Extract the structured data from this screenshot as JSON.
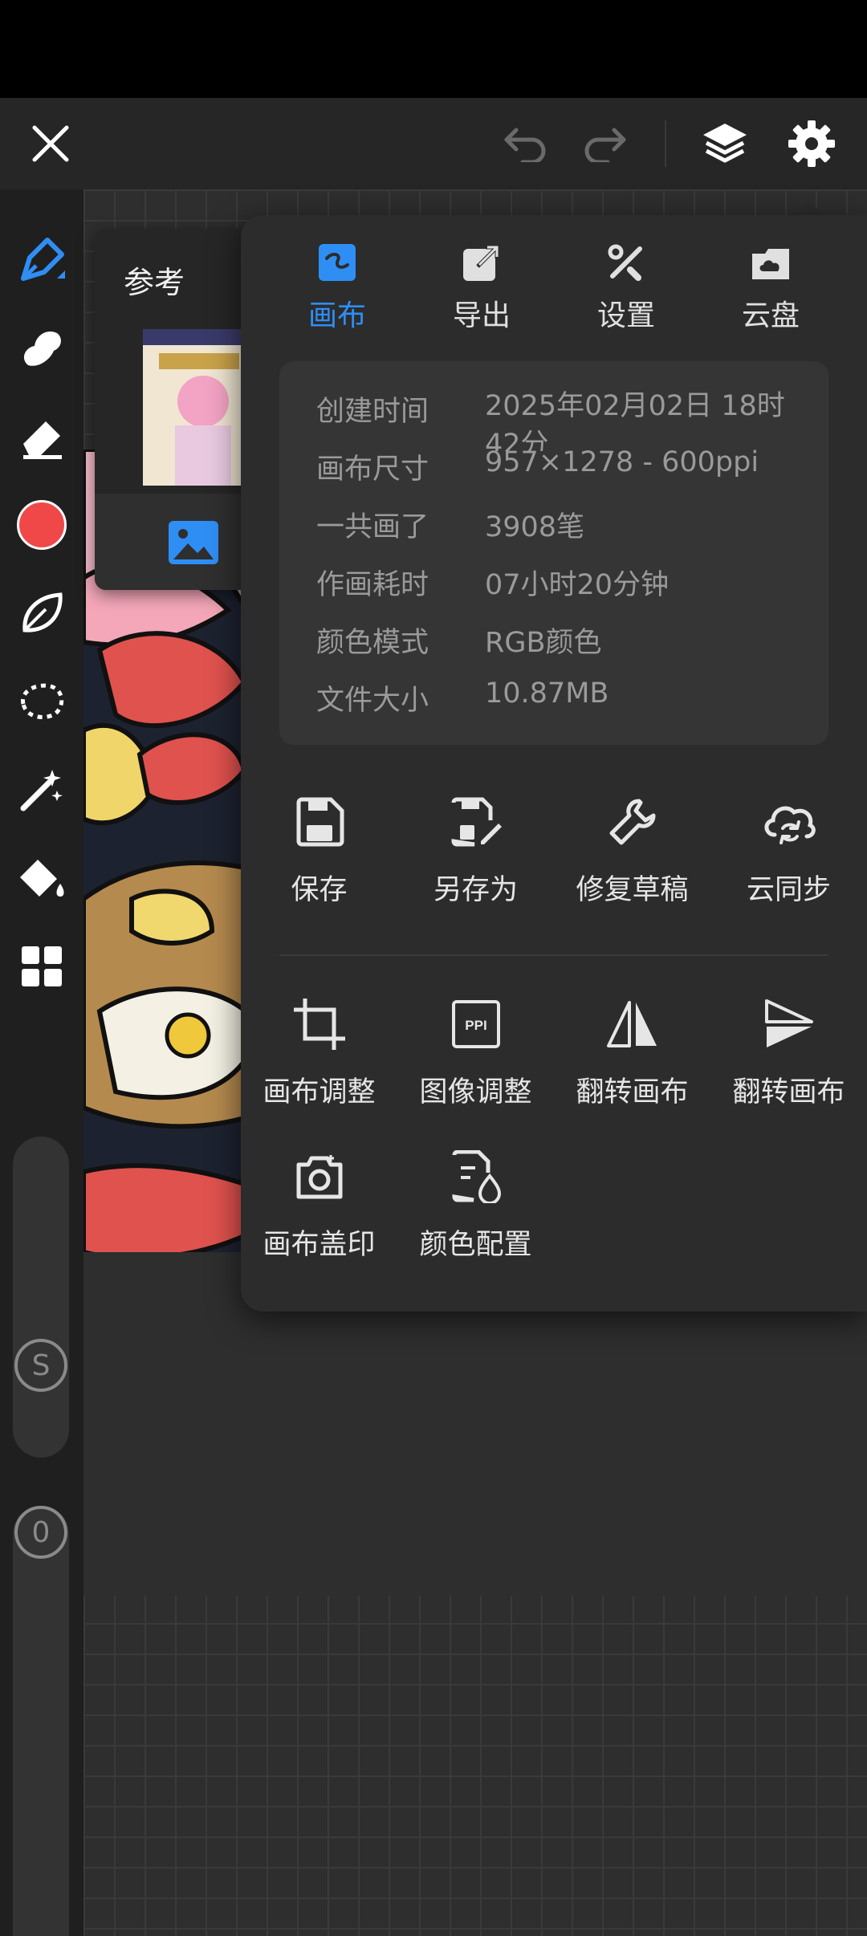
{
  "toolbar": {
    "close": "close",
    "undo": "undo",
    "redo": "redo",
    "layers": "layers",
    "settings": "settings"
  },
  "reference": {
    "title": "参考"
  },
  "popover": {
    "tabs": [
      {
        "label": "画布",
        "icon": "canvas-icon",
        "active": true
      },
      {
        "label": "导出",
        "icon": "export-icon",
        "active": false
      },
      {
        "label": "设置",
        "icon": "settings-tools-icon",
        "active": false
      },
      {
        "label": "云盘",
        "icon": "cloud-drive-icon",
        "active": false
      }
    ],
    "info": [
      {
        "key": "创建时间",
        "value": "2025年02月02日 18时42分"
      },
      {
        "key": "画布尺寸",
        "value": "957×1278 - 600ppi"
      },
      {
        "key": "一共画了",
        "value": "3908笔"
      },
      {
        "key": "作画耗时",
        "value": "07小时20分钟"
      },
      {
        "key": "颜色模式",
        "value": "RGB颜色"
      },
      {
        "key": "文件大小",
        "value": "10.87MB"
      }
    ],
    "actions_row1": [
      {
        "label": "保存",
        "icon": "save-icon"
      },
      {
        "label": "另存为",
        "icon": "save-as-icon"
      },
      {
        "label": "修复草稿",
        "icon": "repair-draft-icon"
      },
      {
        "label": "云同步",
        "icon": "cloud-sync-icon"
      }
    ],
    "actions_row2": [
      {
        "label": "画布调整",
        "icon": "crop-icon"
      },
      {
        "label": "图像调整",
        "icon": "ppi-icon",
        "badge": "PPI"
      },
      {
        "label": "翻转画布",
        "icon": "flip-horizontal-icon"
      },
      {
        "label": "翻转画布",
        "icon": "flip-vertical-icon"
      }
    ],
    "actions_row3": [
      {
        "label": "画布盖印",
        "icon": "camera-stamp-icon"
      },
      {
        "label": "颜色配置",
        "icon": "color-profile-icon"
      }
    ]
  },
  "sidebar": {
    "brush_color": "#f04848",
    "size_badge": "S",
    "opacity_badge": "0"
  },
  "colors": {
    "accent": "#2f8ef4"
  }
}
